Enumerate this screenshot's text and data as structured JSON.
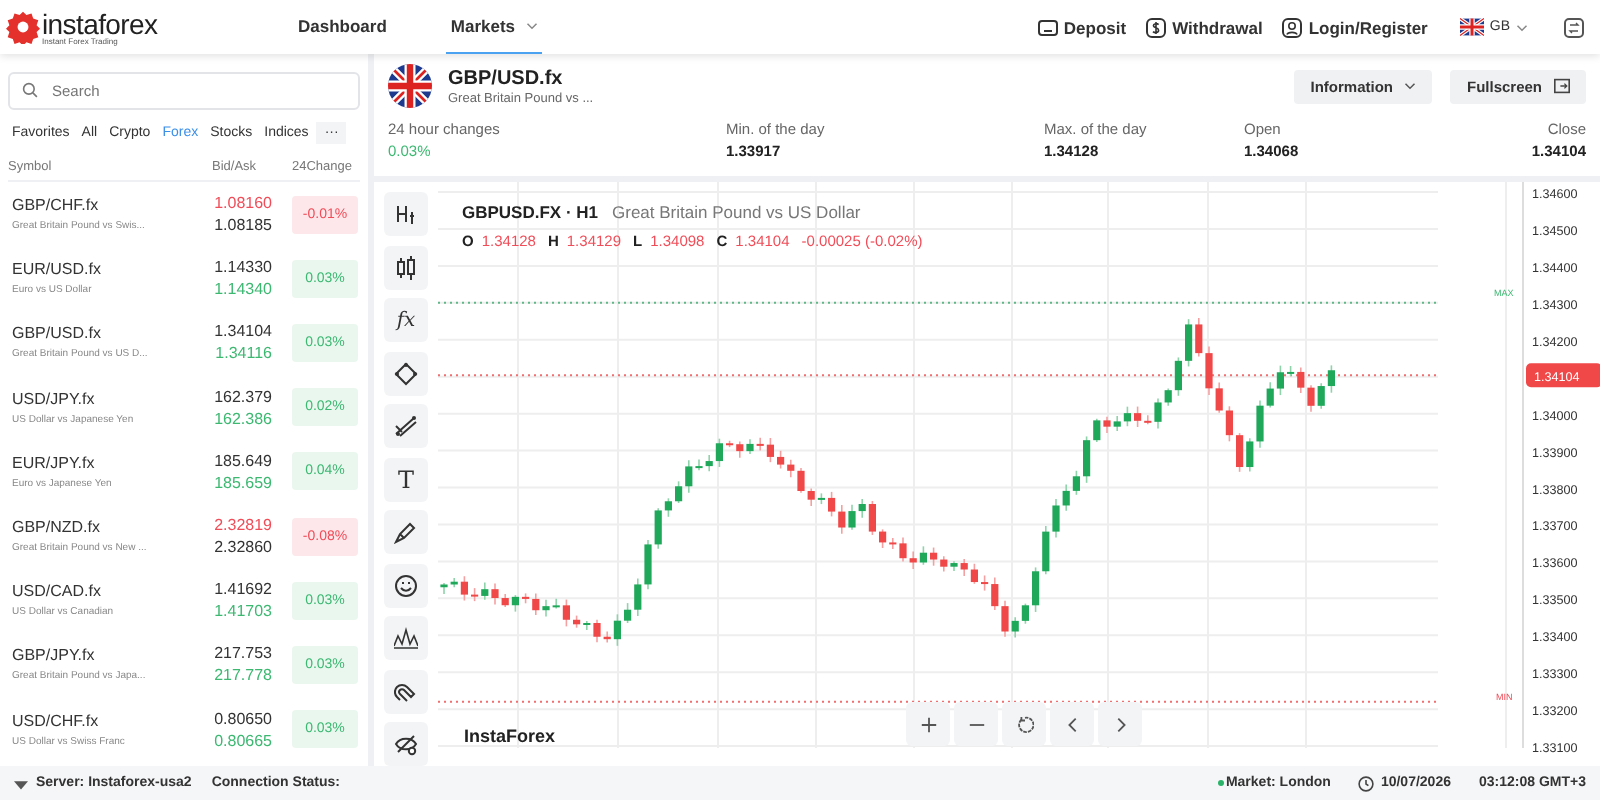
{
  "header": {
    "logo": {
      "name": "instaforex",
      "tagline": "Instant Forex Trading"
    },
    "nav": [
      {
        "label": "Dashboard",
        "selected": false,
        "dropdown": false
      },
      {
        "label": "Markets",
        "selected": true,
        "dropdown": true
      }
    ],
    "actions": [
      {
        "label": "Deposit",
        "kind": "card"
      },
      {
        "label": "Withdrawal",
        "kind": "dollar"
      },
      {
        "label": "Login/Register",
        "kind": "user"
      }
    ],
    "language": "GB"
  },
  "sidebar": {
    "search": {
      "placeholder": "Search"
    },
    "tabs": [
      {
        "label": "Favorites",
        "selected": false
      },
      {
        "label": "All",
        "selected": false
      },
      {
        "label": "Crypto",
        "selected": false
      },
      {
        "label": "Forex",
        "selected": true
      },
      {
        "label": "Stocks",
        "selected": false
      },
      {
        "label": "Indices",
        "selected": false
      }
    ],
    "more": "···",
    "columns": [
      "Symbol",
      "Bid/Ask",
      "24Change"
    ],
    "rows": [
      {
        "symbol": "GBP/CHF.fx",
        "description": "Great Britain Pound vs Swis...",
        "bid": "1.08160",
        "bid_falling": true,
        "ask": "1.08185",
        "ask_rising": false,
        "change": "-0.01%",
        "change_negative": true
      },
      {
        "symbol": "EUR/USD.fx",
        "description": "Euro vs US Dollar",
        "bid": "1.14330",
        "bid_falling": false,
        "ask": "1.14340",
        "ask_rising": true,
        "change": "0.03%",
        "change_negative": false
      },
      {
        "symbol": "GBP/USD.fx",
        "description": "Great Britain Pound vs US D...",
        "bid": "1.34104",
        "bid_falling": false,
        "ask": "1.34116",
        "ask_rising": true,
        "change": "0.03%",
        "change_negative": false
      },
      {
        "symbol": "USD/JPY.fx",
        "description": "US Dollar vs Japanese Yen",
        "bid": "162.379",
        "bid_falling": false,
        "ask": "162.386",
        "ask_rising": true,
        "change": "0.02%",
        "change_negative": false
      },
      {
        "symbol": "EUR/JPY.fx",
        "description": "Euro vs Japanese Yen",
        "bid": "185.649",
        "bid_falling": false,
        "ask": "185.659",
        "ask_rising": true,
        "change": "0.04%",
        "change_negative": false
      },
      {
        "symbol": "GBP/NZD.fx",
        "description": "Great Britain Pound vs New ...",
        "bid": "2.32819",
        "bid_falling": true,
        "ask": "2.32860",
        "ask_rising": false,
        "change": "-0.08%",
        "change_negative": true
      },
      {
        "symbol": "USD/CAD.fx",
        "description": "US Dollar vs Canadian",
        "bid": "1.41692",
        "bid_falling": false,
        "ask": "1.41703",
        "ask_rising": true,
        "change": "0.03%",
        "change_negative": false
      },
      {
        "symbol": "GBP/JPY.fx",
        "description": "Great Britain Pound vs Japa...",
        "bid": "217.753",
        "bid_falling": false,
        "ask": "217.778",
        "ask_rising": true,
        "change": "0.03%",
        "change_negative": false
      },
      {
        "symbol": "USD/CHF.fx",
        "description": "US Dollar vs Swiss Franc",
        "bid": "0.80650",
        "bid_falling": false,
        "ask": "0.80665",
        "ask_rising": true,
        "change": "0.03%",
        "change_negative": false
      }
    ]
  },
  "instrument": {
    "symbol": "GBP/USD.fx",
    "description": "Great Britain Pound vs ...",
    "buttons": [
      {
        "label": "Information",
        "kind": "dropdown"
      },
      {
        "label": "Fullscreen",
        "kind": "fullscreen"
      }
    ],
    "stats": [
      {
        "label": "24 hour changes",
        "value": "0.03%",
        "positive": true
      },
      {
        "label": "Min. of the day",
        "value": "1.33917",
        "positive": false
      },
      {
        "label": "Max. of the day",
        "value": "1.34128",
        "positive": false
      },
      {
        "label": "Open",
        "value": "1.34068",
        "positive": false
      },
      {
        "label": "Close",
        "value": "1.34104",
        "positive": false
      }
    ]
  },
  "chart": {
    "title": "GBPUSD.FX · H1",
    "description": "Great Britain Pound vs US Dollar",
    "ohlc": [
      {
        "key": "O",
        "value": "1.34128"
      },
      {
        "key": "H",
        "value": "1.34129"
      },
      {
        "key": "L",
        "value": "1.34098"
      },
      {
        "key": "C",
        "value": "1.34104"
      }
    ],
    "delta": "-0.00025 (-0.02%)",
    "price_axis": [
      "1.34600",
      "1.34500",
      "1.34400",
      "1.34300",
      "1.34200",
      "1.34000",
      "1.33900",
      "1.33800",
      "1.33700",
      "1.33600",
      "1.33500",
      "1.33400",
      "1.33300",
      "1.33200",
      "1.33100"
    ],
    "current_price": "1.34104",
    "max_label": "MAX",
    "min_label": "MIN",
    "brand": "InstaForex",
    "tools": [
      {
        "kind": "bars"
      },
      {
        "kind": "candle"
      },
      {
        "kind": "text",
        "label": "fx"
      },
      {
        "kind": "shape"
      },
      {
        "kind": "lines"
      },
      {
        "kind": "text",
        "label": "T"
      },
      {
        "kind": "brush"
      },
      {
        "kind": "smile"
      },
      {
        "kind": "wave"
      },
      {
        "kind": "magnet"
      },
      {
        "kind": "eye"
      }
    ],
    "controls": [
      {
        "kind": "zoom-in"
      },
      {
        "kind": "zoom-out"
      },
      {
        "kind": "reset"
      },
      {
        "kind": "prev"
      },
      {
        "kind": "next"
      }
    ]
  },
  "status_bar": {
    "server": "Server: Instaforex-usa2",
    "connection": "Connection Status:",
    "market": "Market: London",
    "date": "10/07/2026",
    "time": "03:12:08 GMT+3"
  }
}
